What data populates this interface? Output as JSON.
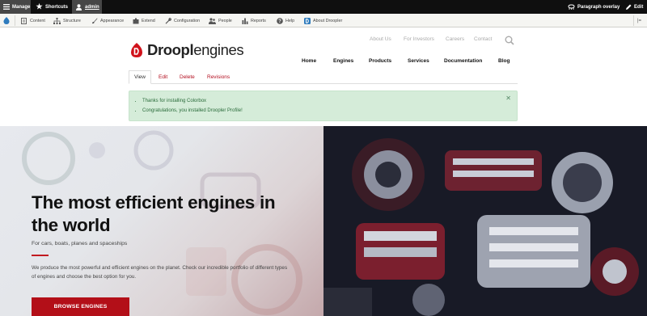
{
  "toolbar": {
    "manage": "Manage",
    "shortcuts": "Shortcuts",
    "user": "admin",
    "paragraph_overlay": "Paragraph overlay",
    "edit": "Edit"
  },
  "admin_menu": {
    "items": [
      "Content",
      "Structure",
      "Appearance",
      "Extend",
      "Configuration",
      "People",
      "Reports",
      "Help",
      "About Droopler"
    ]
  },
  "site": {
    "logo_bold": "Droopl",
    "logo_light": "engines",
    "utility_nav": [
      "About Us",
      "For Investors",
      "Careers",
      "Contact"
    ],
    "main_nav": [
      "Home",
      "Engines",
      "Products",
      "Services",
      "Documentation",
      "Blog"
    ]
  },
  "tabs": [
    "View",
    "Edit",
    "Delete",
    "Revisions"
  ],
  "messages": [
    "Thanks for installing Colorbox",
    "Congratulations, you installed Droopler Profile!"
  ],
  "hero": {
    "title": "The most efficient engines in the world",
    "subtitle": "For cars, boats, planes and spaceships",
    "body": "We produce the most powerful and efficient engines on the planet. Check our incredible portfolio of different types of engines and choose the best option for you.",
    "button": "BROWSE ENGINES"
  },
  "colors": {
    "accent": "#b30f18",
    "success_bg": "#d5ecd9",
    "toolbar": "#0f0f0f"
  }
}
